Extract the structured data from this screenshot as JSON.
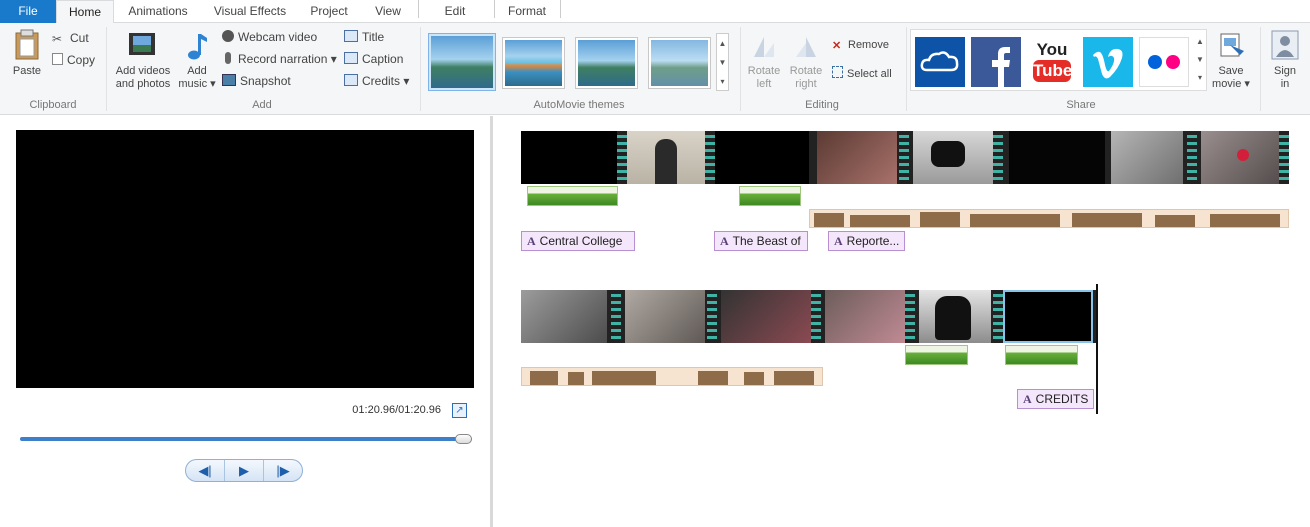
{
  "tabs": {
    "file": "File",
    "home": "Home",
    "animations": "Animations",
    "visual_effects": "Visual Effects",
    "project": "Project",
    "view": "View",
    "edit": "Edit",
    "format": "Format"
  },
  "clipboard": {
    "paste": "Paste",
    "cut": "Cut",
    "copy": "Copy",
    "label": "Clipboard"
  },
  "add": {
    "add_videos_1": "Add videos",
    "add_videos_2": "and photos",
    "add_music_1": "Add",
    "add_music_2": "music ▾",
    "webcam": "Webcam video",
    "narration": "Record narration ▾",
    "snapshot": "Snapshot",
    "title": "Title",
    "caption": "Caption",
    "credits": "Credits ▾",
    "label": "Add"
  },
  "themes": {
    "label": "AutoMovie themes"
  },
  "editing": {
    "rotate_left_1": "Rotate",
    "rotate_left_2": "left",
    "rotate_right_1": "Rotate",
    "rotate_right_2": "right",
    "remove": "Remove",
    "select_all": "Select all",
    "label": "Editing"
  },
  "share": {
    "save_movie_1": "Save",
    "save_movie_2": "movie ▾",
    "sign_in_1": "Sign",
    "sign_in_2": "in",
    "label": "Share",
    "youtube_1": "You",
    "youtube_2": "Tube"
  },
  "player": {
    "time": "01:20.96/01:20.96",
    "progress": 1.0
  },
  "captions": {
    "c1": "Central College",
    "c2": "The Beast of",
    "c3": "Reporte...",
    "c4": "CREDITS"
  },
  "colors": {
    "file_tab": "#1979ca",
    "onedrive": "#0d54a8",
    "facebook": "#3b5998",
    "youtube": "#e52d27",
    "vimeo": "#1ab7ea",
    "flickr_blue": "#0063dc",
    "flickr_pink": "#ff0084"
  }
}
